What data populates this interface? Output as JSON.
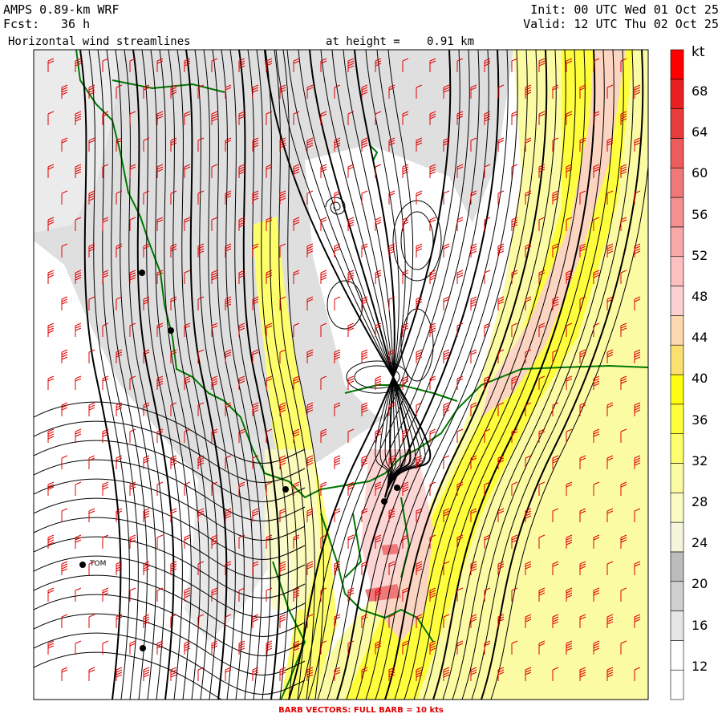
{
  "header": {
    "model": "AMPS 0.89-km WRF",
    "forecast_label": "Fcst:",
    "forecast_value": "36 h",
    "product": "Horizontal wind streamlines",
    "height_label": "at height =",
    "height_value": "0.91 km",
    "init": "Init: 00 UTC Wed 01 Oct 25",
    "valid": "Valid: 12 UTC Thu 02 Oct 25"
  },
  "footer": {
    "barb_note": "BARB VECTORS:  FULL BARB = 10 kts"
  },
  "colorbar": {
    "unit": "kt",
    "tick_labels": [
      "68",
      "64",
      "60",
      "56",
      "52",
      "48",
      "44",
      "40",
      "36",
      "32",
      "28",
      "24",
      "20",
      "16",
      "12"
    ],
    "colors": [
      "#ffffff",
      "#ffffff",
      "#e6e6e6",
      "#cfcfcf",
      "#bcbcbc",
      "#f5f5dc",
      "#fbfbc4",
      "#fbfba4",
      "#fefe6c",
      "#fefe3c",
      "#fefe10",
      "#fbe070",
      "#fcd8b0",
      "#fcd0d0",
      "#fcc0c0",
      "#f8a8a8",
      "#f49090",
      "#f07878",
      "#ec5c5c",
      "#e83c3c",
      "#e82020",
      "#ff0000"
    ]
  },
  "sites": [
    {
      "name": ""
    },
    {
      "name": ""
    },
    {
      "name": ""
    },
    {
      "name": ""
    },
    {
      "name": ""
    },
    {
      "name": "TOM"
    },
    {
      "name": ""
    }
  ],
  "legend_colors": {
    "streamline": "#000000",
    "barb": "#e00000",
    "coastline": "#007700"
  }
}
